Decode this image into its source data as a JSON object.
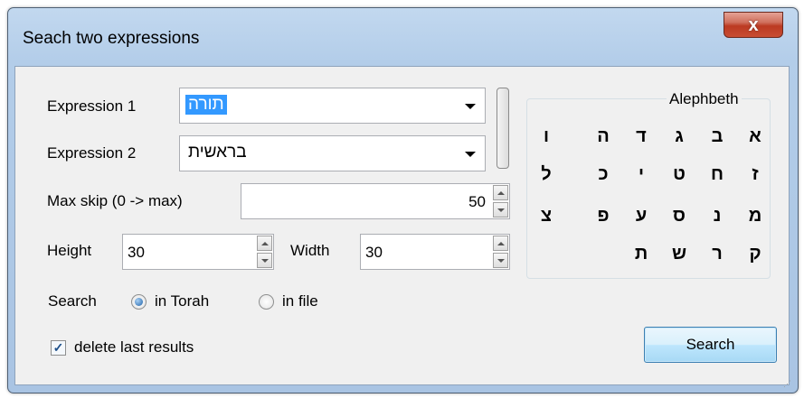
{
  "window": {
    "title": "Seach two expressions",
    "close_label": "x"
  },
  "form": {
    "expr1_label": "Expression 1",
    "expr1_value": "תורה",
    "expr2_label": "Expression 2",
    "expr2_value": "בראשית",
    "maxskip_label": "Max skip (0 -> max)",
    "maxskip_value": "50",
    "height_label": "Height",
    "height_value": "30",
    "width_label": "Width",
    "width_value": "30",
    "search_label": "Search",
    "radio_torah": "in Torah",
    "radio_file": "in file",
    "delete_label": "delete last results",
    "delete_checked": true,
    "search_button": "Search"
  },
  "alephbeth": {
    "title": "Alephbeth",
    "letters": [
      "א",
      "ב",
      "ג",
      "ד",
      "ה",
      "ו",
      "ז",
      "ח",
      "ט",
      "י",
      "כ",
      "ל",
      "מ",
      "נ",
      "ס",
      "ע",
      "פ",
      "צ",
      "ק",
      "ר",
      "ש",
      "ת"
    ]
  }
}
